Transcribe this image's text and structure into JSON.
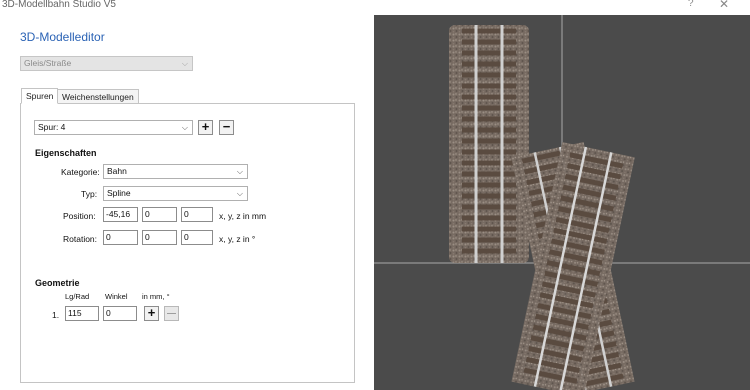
{
  "window": {
    "title": "3D-Modellbahn Studio V5",
    "help": "?",
    "close": "✕"
  },
  "editor": {
    "heading": "3D-Modelleditor",
    "object_type": "Gleis/Straße",
    "tabs": [
      "Spuren",
      "Weichenstellungen"
    ]
  },
  "spur": {
    "selected": "Spur: 4",
    "add": "+",
    "remove": "−"
  },
  "eigenschaften": {
    "heading": "Eigenschaften",
    "kategorie_label": "Kategorie:",
    "kategorie_value": "Bahn",
    "typ_label": "Typ:",
    "typ_value": "Spline",
    "position_label": "Position:",
    "position": [
      "-45,16",
      "0",
      "0"
    ],
    "position_unit": "x, y, z in mm",
    "rotation_label": "Rotation:",
    "rotation": [
      "0",
      "0",
      "0"
    ],
    "rotation_unit": "x, y, z in °"
  },
  "geometrie": {
    "heading": "Geometrie",
    "col_length": "Lg/Rad",
    "col_angle": "Winkel",
    "col_unit": "in mm, °",
    "rows": [
      {
        "index": "1.",
        "length": "115",
        "angle": "0"
      }
    ],
    "add": "+",
    "remove": "—"
  },
  "colors": {
    "accent": "#2b63b5",
    "viewport_bg": "#4b4b4b",
    "grid_line": "#8a8a8a",
    "rail": "#c8c8c8",
    "ballast": "#7b6f66",
    "sleeper": "#5a4b40"
  }
}
